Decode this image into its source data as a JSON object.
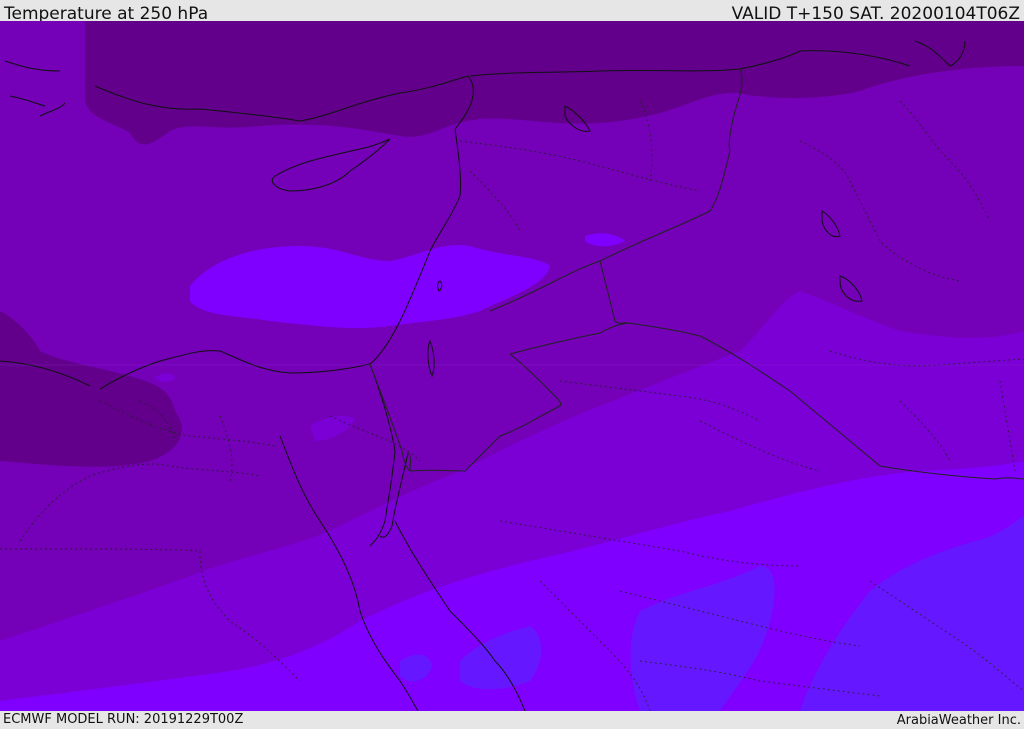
{
  "header": {
    "title": "Temperature at 250 hPa",
    "valid": "VALID T+150 SAT. 20200104T06Z"
  },
  "footer": {
    "model_run": "ECMWF MODEL RUN: 20191229T00Z",
    "credit": "ArabiaWeather Inc."
  },
  "map": {
    "region": "Eastern Mediterranean and Middle East",
    "variable": "Temperature at 250 hPa",
    "colors": {
      "coldest": "#62008c",
      "cold": "#6e00a8",
      "cool": "#7400b8",
      "mid": "#7a00d6",
      "warm": "#8000ff",
      "warmest": "#6518ff",
      "coast": "#111111",
      "border": "#222222"
    }
  }
}
